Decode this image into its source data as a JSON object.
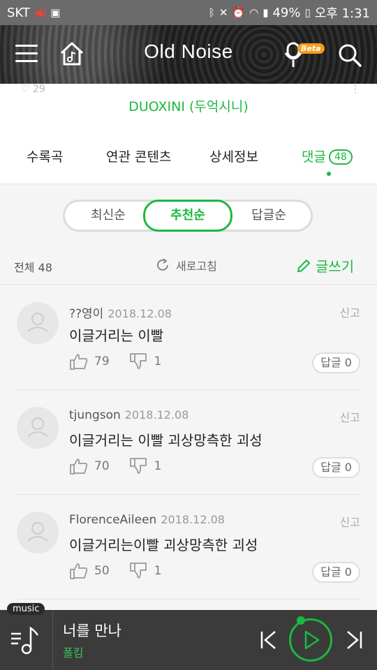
{
  "statusbar": {
    "carrier": "SKT",
    "battery": "49%",
    "time": "오후 1:31"
  },
  "header": {
    "title": "Old Noise",
    "beta_label": "Beta"
  },
  "artist_area": {
    "artist_name": "DUOXINI (두억시니)",
    "peek_left": "♡ 29",
    "peek_right": "⋮"
  },
  "tabs": [
    {
      "label": "수록곡"
    },
    {
      "label": "연관 콘텐츠"
    },
    {
      "label": "상세정보"
    },
    {
      "label": "댓글",
      "count": "48",
      "active": true
    }
  ],
  "sort": {
    "options": [
      "최신순",
      "추천순",
      "답글순"
    ],
    "selected": "추천순"
  },
  "list_bar": {
    "total": "전체 48",
    "refresh": "새로고침",
    "write": "글쓰기"
  },
  "comments": [
    {
      "user": "??영이",
      "date": "2018.12.08",
      "report": "신고",
      "text": "이글거리는 이빨",
      "likes": "79",
      "dislikes": "1",
      "reply": "답글 0"
    },
    {
      "user": "tjungson",
      "date": "2018.12.08",
      "report": "신고",
      "text": "이글거리는 이빨 괴상망측한 괴성",
      "likes": "70",
      "dislikes": "1",
      "reply": "답글 0"
    },
    {
      "user": "FlorenceAileen",
      "date": "2018.12.08",
      "report": "신고",
      "text": "이글거리는이빨 괴상망측한 괴성",
      "likes": "50",
      "dislikes": "1",
      "reply": "답글 0"
    }
  ],
  "player": {
    "badge": "music",
    "song": "너를 만나",
    "artist": "폴킴"
  }
}
